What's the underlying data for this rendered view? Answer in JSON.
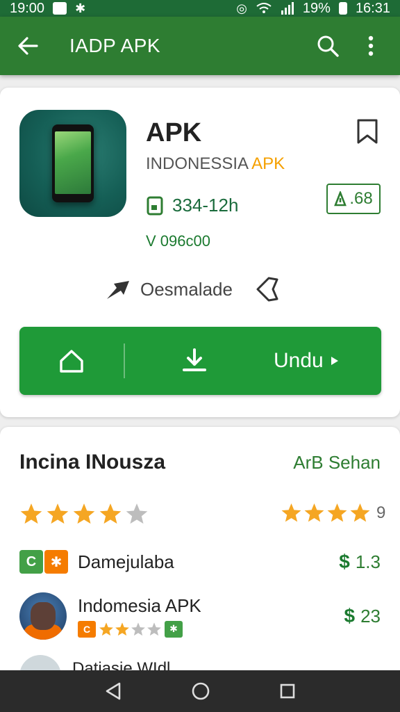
{
  "status_bar": {
    "time_left": "19:00",
    "battery": "19%",
    "time_right": "16:31"
  },
  "app_bar": {
    "title": "IADP APK"
  },
  "app": {
    "name": "APK",
    "developer_prefix": "INDONESSIA",
    "developer_accent": "APK",
    "size": "334-12h",
    "rating_value": ".68",
    "version": "V 096c00",
    "meta_label": "Oesmalade"
  },
  "install_bar": {
    "install_label": "Undu"
  },
  "section": {
    "title": "Incina INouszа",
    "link": "ArB Sehan",
    "stars_left_filled": 4,
    "stars_left_total": 5,
    "stars_right_count": "9"
  },
  "list": [
    {
      "label": "Damejulaba",
      "value": "1.3"
    },
    {
      "label": "Indomesia APK",
      "value": "23"
    },
    {
      "label": "Datiasie WIdl"
    }
  ],
  "colors": {
    "primary": "#2e7d32",
    "install_green": "#1f9a38",
    "accent_orange": "#f5a000",
    "star": "#f5a623"
  }
}
